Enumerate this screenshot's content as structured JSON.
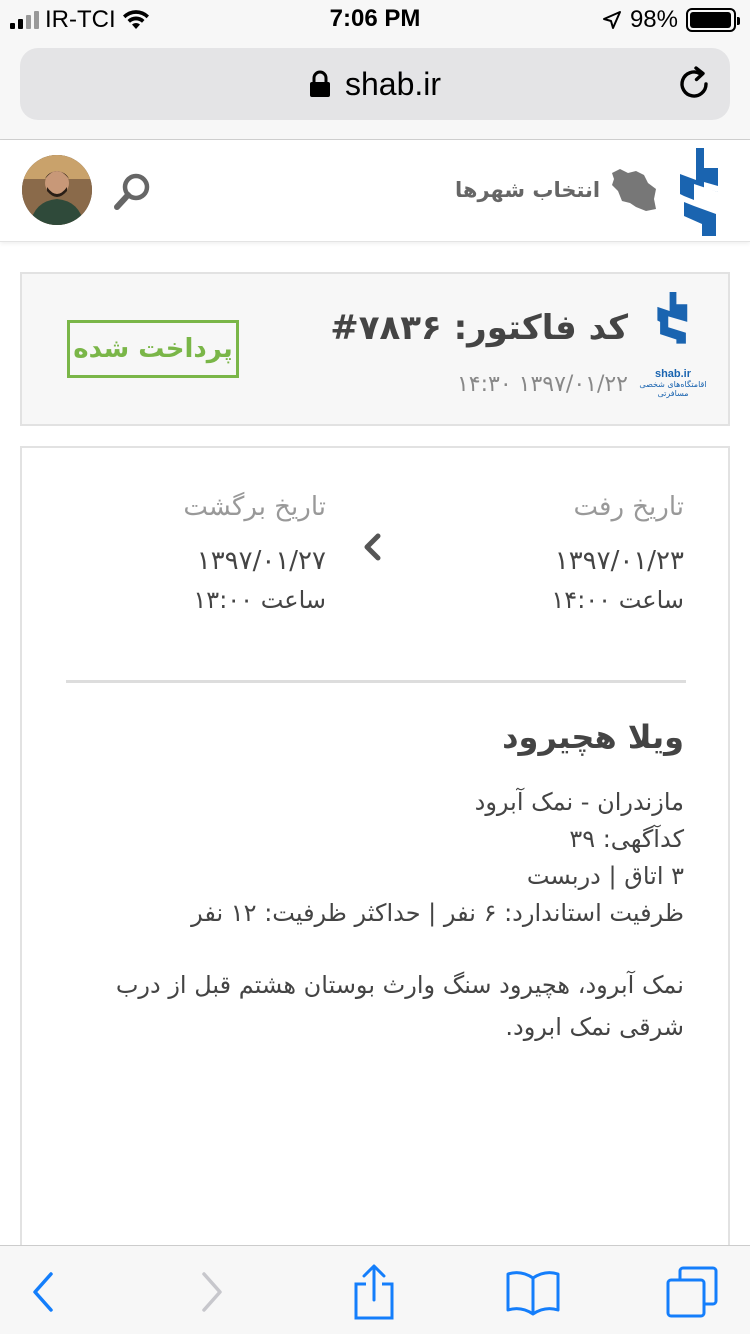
{
  "status_bar": {
    "carrier": "IR-TCI",
    "time": "7:06 PM",
    "battery_percent_label": "98%",
    "battery_level": 0.98
  },
  "browser": {
    "url": "shab.ir"
  },
  "header": {
    "city_select_label": "انتخاب شهرها"
  },
  "invoice": {
    "code_label": "کد فاکتور: ۷۸۳۶#",
    "datetime": "۱۳۹۷/۰۱/۲۲ ۱۴:۳۰",
    "status_badge": "پرداخت شده",
    "logo_text": "shab.ir",
    "logo_subtext": "اقامتگاه‌های شخصی مسافرتی"
  },
  "booking": {
    "checkin_label": "تاریخ رفت",
    "checkin_date": "۱۳۹۷/۰۱/۲۳",
    "checkin_time": "ساعت ۱۴:۰۰",
    "checkout_label": "تاریخ برگشت",
    "checkout_date": "۱۳۹۷/۰۱/۲۷",
    "checkout_time": "ساعت ۱۳:۰۰",
    "villa_title": "ویلا هچیرود",
    "location": "مازندران - نمک آبرود",
    "ad_code": "کدآگهی: ۳۹",
    "rooms": "۳ اتاق | دربست",
    "capacity": "ظرفیت استاندارد: ۶ نفر | حداکثر ظرفیت: ۱۲ نفر",
    "description": "نمک آبرود، هچیرود سنگ وارث بوستان هشتم قبل از درب شرقی نمک ابرود."
  },
  "colors": {
    "brand_blue": "#1a64b0",
    "paid_green": "#7ab648",
    "ios_blue": "#147efb"
  }
}
